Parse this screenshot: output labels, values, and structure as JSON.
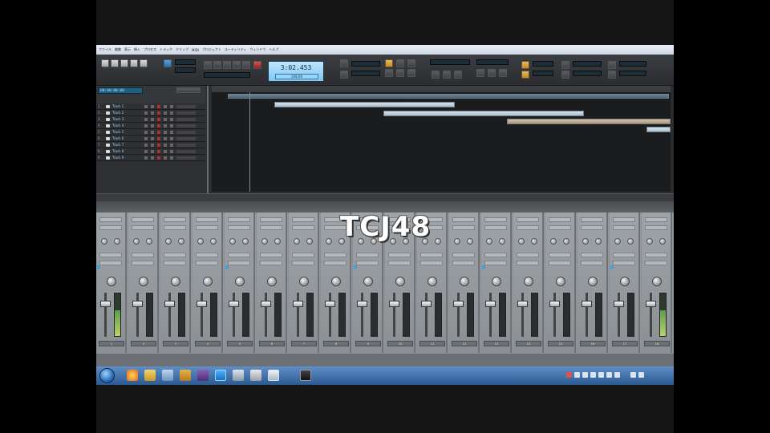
{
  "overlay": {
    "title": "TCJ48"
  },
  "menu": {
    "items": [
      "ファイル",
      "編集",
      "表示",
      "挿入",
      "プロセス",
      "トラック",
      "クリップ",
      "MIDI",
      "プロジェクト",
      "ユーティリティ",
      "ウィンドウ",
      "ヘルプ"
    ]
  },
  "transport": {
    "time_main": "3:02.453",
    "time_sub": "108.00"
  },
  "tracks": {
    "position": "00:00:00:00",
    "rows": [
      {
        "num": "1",
        "name": "Track 1"
      },
      {
        "num": "2",
        "name": "Track 2"
      },
      {
        "num": "3",
        "name": "Track 3"
      },
      {
        "num": "4",
        "name": "Track 4"
      },
      {
        "num": "5",
        "name": "Track 5"
      },
      {
        "num": "6",
        "name": "Track 6"
      },
      {
        "num": "7",
        "name": "Track 7"
      },
      {
        "num": "8",
        "name": "Track 8"
      },
      {
        "num": "9",
        "name": "Track 9"
      }
    ]
  },
  "mixer": {
    "strips": [
      {
        "name": "1"
      },
      {
        "name": "2"
      },
      {
        "name": "3"
      },
      {
        "name": "4"
      },
      {
        "name": "5"
      },
      {
        "name": "6"
      },
      {
        "name": "7"
      },
      {
        "name": "8"
      },
      {
        "name": "9"
      },
      {
        "name": "10"
      },
      {
        "name": "11"
      },
      {
        "name": "12"
      },
      {
        "name": "13"
      },
      {
        "name": "14"
      },
      {
        "name": "15"
      },
      {
        "name": "16"
      },
      {
        "name": "17"
      },
      {
        "name": "18"
      }
    ]
  },
  "taskbar": {
    "clock_time": "",
    "clock_date": ""
  },
  "colors": {
    "accent": "#7cc7f2",
    "taskbar": "#2b5a92",
    "mixer": "#8f9397"
  }
}
